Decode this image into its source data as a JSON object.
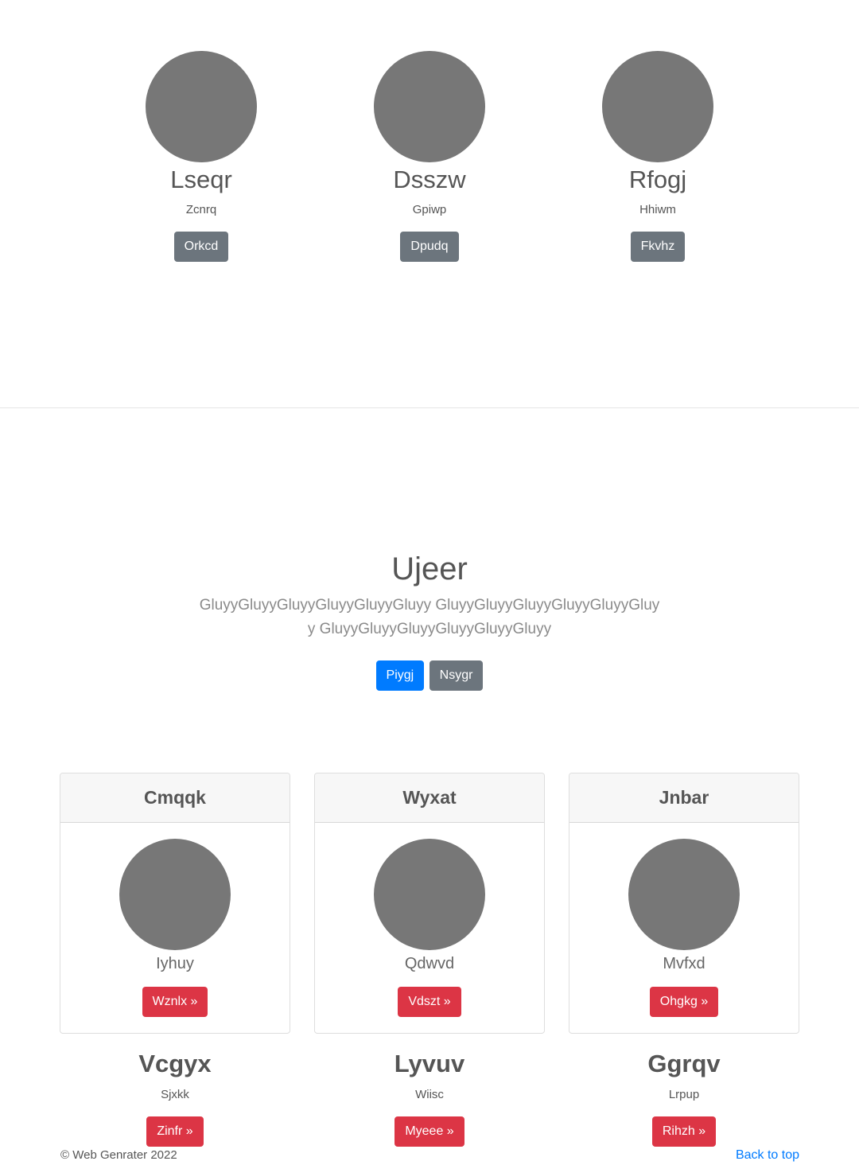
{
  "people": [
    {
      "name": "Lseqr",
      "subtitle": "Zcnrq",
      "button": "Orkcd"
    },
    {
      "name": "Dsszw",
      "subtitle": "Gpiwp",
      "button": "Dpudq"
    },
    {
      "name": "Rfogj",
      "subtitle": "Hhiwm",
      "button": "Fkvhz"
    }
  ],
  "hero": {
    "title": "Ujeer",
    "lead": "GluyyGluyyGluyyGluyyGluyyGluyy GluyyGluyyGluyyGluyyGluyyGluyy GluyyGluyyGluyyGluyyGluyyGluyy",
    "primary_button": "Piygj",
    "secondary_button": "Nsygr"
  },
  "cards": [
    {
      "header": "Cmqqk",
      "text": "Iyhuy",
      "button": "Wznlx »"
    },
    {
      "header": "Wyxat",
      "text": "Qdwvd",
      "button": "Vdszt »"
    },
    {
      "header": "Jnbar",
      "text": "Mvfxd",
      "button": "Ohgkg »"
    }
  ],
  "features": [
    {
      "title": "Vcgyx",
      "subtitle": "Sjxkk",
      "button": "Zinfr »"
    },
    {
      "title": "Lyvuv",
      "subtitle": "Wiisc",
      "button": "Myeee »"
    },
    {
      "title": "Ggrqv",
      "subtitle": "Lrpup",
      "button": "Rihzh »"
    }
  ],
  "footer": {
    "copyright": "© Web Genrater 2022",
    "back_to_top": "Back to top"
  },
  "colors": {
    "avatar": "#777777",
    "primary": "#007bff",
    "secondary": "#6c757d",
    "danger": "#dc3545"
  }
}
